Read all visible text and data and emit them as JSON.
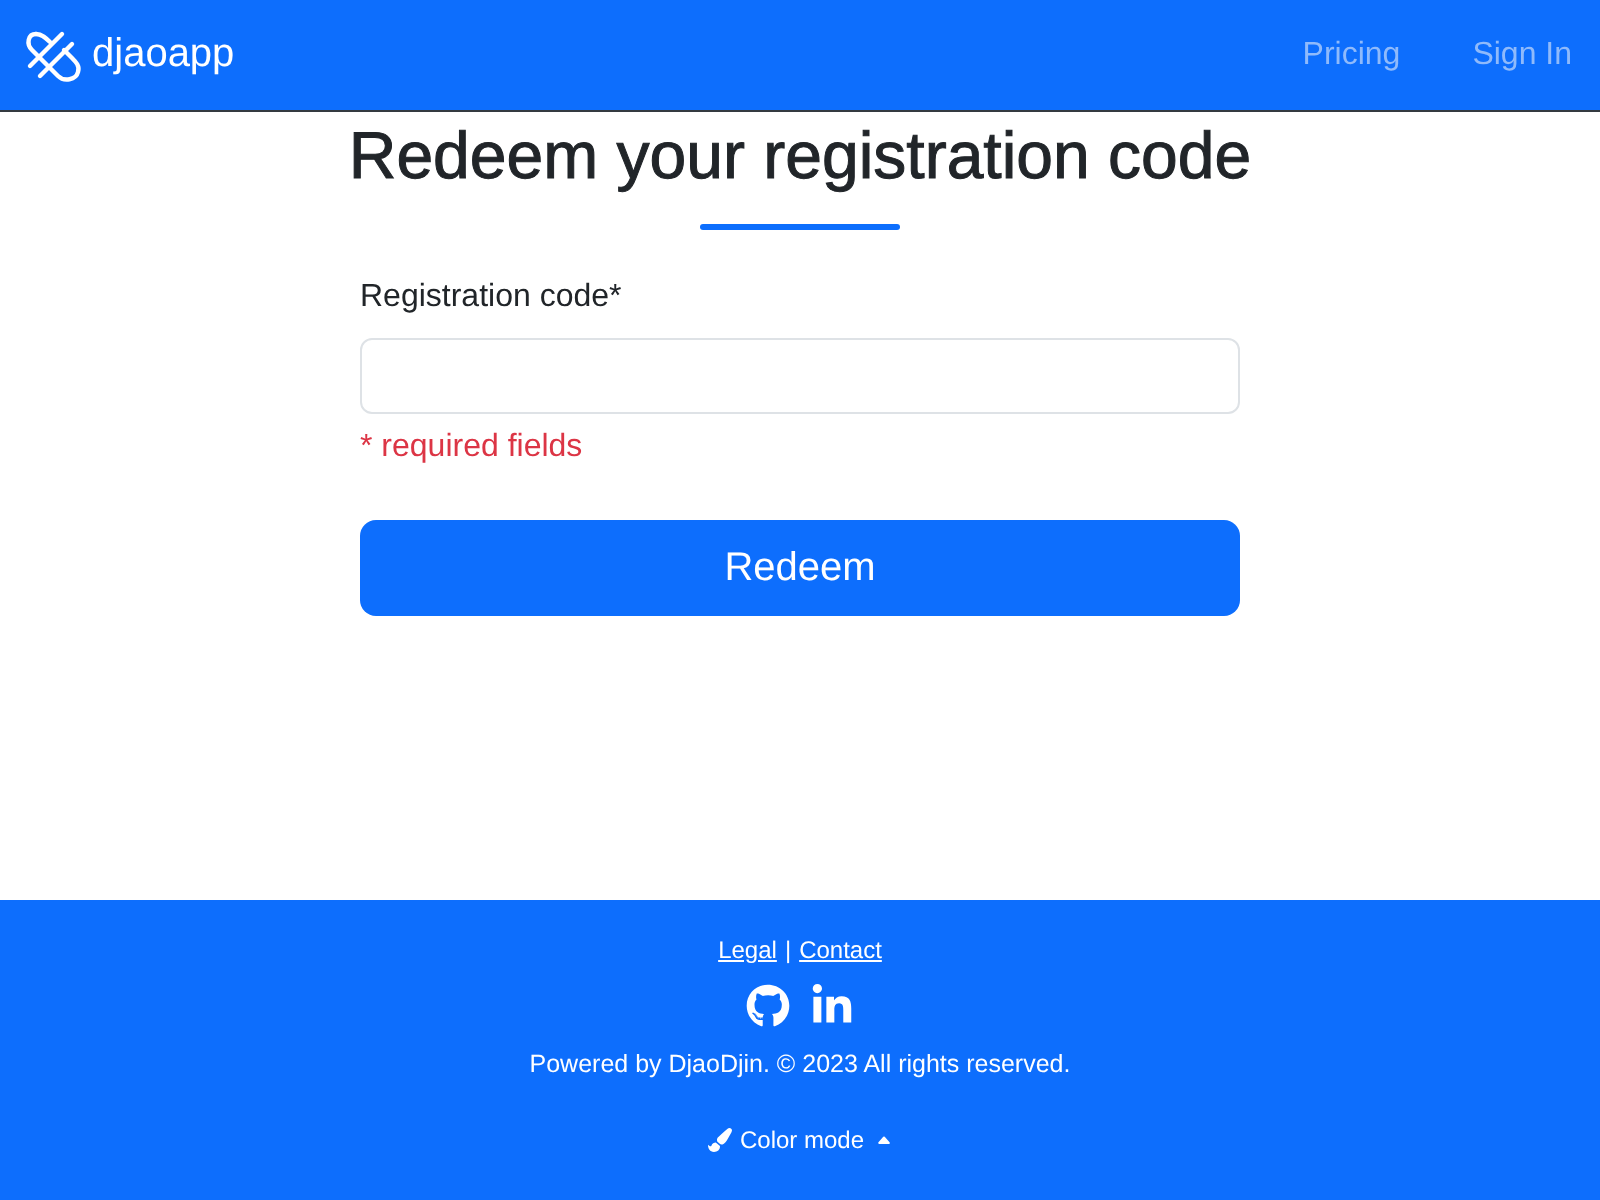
{
  "navbar": {
    "brand": "djaoapp",
    "links": [
      {
        "label": "Pricing"
      },
      {
        "label": "Sign In"
      }
    ]
  },
  "form": {
    "title": "Redeem your registration code",
    "field_label": "Registration code*",
    "required_note": "* required fields",
    "submit": "Redeem"
  },
  "footer": {
    "links": [
      "Legal",
      "Contact"
    ],
    "separator": "|",
    "social": [
      {
        "kind": "github"
      },
      {
        "kind": "linkedin"
      }
    ],
    "copyright": "Powered by DjaoDjin. © 2023 All rights reserved.",
    "color_mode": "Color mode"
  }
}
